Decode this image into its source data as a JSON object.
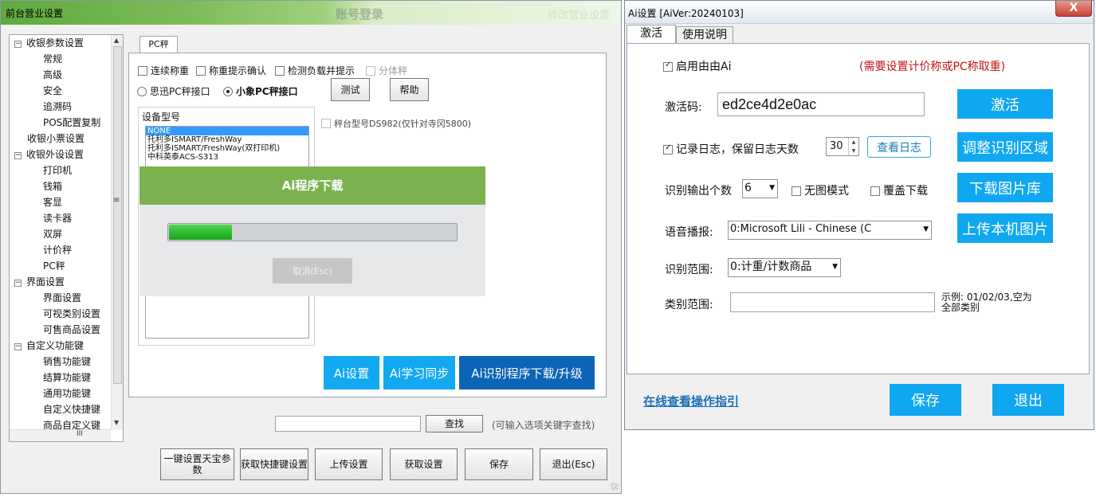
{
  "left_window": {
    "title": "前台营业设置",
    "ghost_title": "账号登录",
    "ghost_title_2": "修改营业设置",
    "tree": [
      {
        "label": "收银参数设置",
        "level": 0,
        "toggle": "−"
      },
      {
        "label": "常规",
        "level": 1
      },
      {
        "label": "高级",
        "level": 1
      },
      {
        "label": "安全",
        "level": 1
      },
      {
        "label": "追溯码",
        "level": 1
      },
      {
        "label": "POS配置复制",
        "level": 1
      },
      {
        "label": "收银小票设置",
        "level": 0,
        "toggle": ""
      },
      {
        "label": "收银外设设置",
        "level": 0,
        "toggle": "−"
      },
      {
        "label": "打印机",
        "level": 1
      },
      {
        "label": "钱箱",
        "level": 1
      },
      {
        "label": "客显",
        "level": 1
      },
      {
        "label": "读卡器",
        "level": 1
      },
      {
        "label": "双屏",
        "level": 1
      },
      {
        "label": "计价秤",
        "level": 1
      },
      {
        "label": "PC秤",
        "level": 1
      },
      {
        "label": "界面设置",
        "level": 0,
        "toggle": "−"
      },
      {
        "label": "界面设置",
        "level": 1
      },
      {
        "label": "可视类别设置",
        "level": 1
      },
      {
        "label": "可售商品设置",
        "level": 1
      },
      {
        "label": "自定义功能键",
        "level": 0,
        "toggle": "−"
      },
      {
        "label": "销售功能键",
        "level": 1
      },
      {
        "label": "结算功能键",
        "level": 1
      },
      {
        "label": "通用功能键",
        "level": 1
      },
      {
        "label": "自定义快捷键",
        "level": 1
      },
      {
        "label": "商品自定义键",
        "level": 1
      }
    ],
    "tab_label": "PC秤",
    "checkboxes": [
      {
        "label": "连续称重",
        "checked": false
      },
      {
        "label": "称重提示确认",
        "checked": false
      },
      {
        "label": "检测负载并提示",
        "checked": false
      },
      {
        "label": "分体秤",
        "checked": false,
        "disabled": true
      }
    ],
    "radio_sixun": "思迅PC秤接口",
    "radio_xiaoxiang": "小象PC秤接口",
    "test_button": "测试",
    "help_button": "帮助",
    "device_model_label": "设备型号",
    "devices": [
      "NONE",
      "托利多ISMART/FreshWay",
      "托利多ISMART/FreshWay(双打印机)",
      "中科英泰ACS-S313"
    ],
    "ds982_label": "秤台型号DS982(仅针对寺冈5800)",
    "download_dialog": {
      "title": "Ai程序下载",
      "progress": 0.22,
      "cancel_label": "取消(Esc)"
    },
    "ai_buttons": [
      "Ai设置",
      "Ai学习同步",
      "Ai识别程序下载/升级"
    ],
    "search_value": "",
    "search_button": "查找",
    "search_hint": "(可输入选项关键字查找)",
    "bottom_buttons": [
      "一键设置天宝参数",
      "获取快捷键设置",
      "上传设置",
      "获取设置",
      "保存",
      "退出(Esc)"
    ]
  },
  "right_window": {
    "title": "Ai设置 [AiVer:20240103]",
    "close_label": "X",
    "tabs": [
      "激活",
      "使用说明"
    ],
    "enable_ai_label": "启用由由Ai",
    "enable_ai_checked": true,
    "red_note": "(需要设置计价称或PC称取重)",
    "activation_label": "激活码:",
    "activation_code": "ed2ce4d2e0ac",
    "activate_button": "激活",
    "log_label": "记录日志，保留日志天数",
    "log_checked": true,
    "log_days": "30",
    "view_log_button": "查看日志",
    "adjust_area_button": "调整识别区域",
    "output_count_label": "识别输出个数",
    "output_count_value": "6",
    "no_image_label": "无图模式",
    "overwrite_label": "覆盖下载",
    "download_lib_button": "下载图片库",
    "voice_label": "语音播报:",
    "voice_value": "0:Microsoft Lili - Chinese (C",
    "upload_button": "上传本机图片",
    "range_label": "识别范围:",
    "range_value": "0:计重/计数商品",
    "category_label": "类别范围:",
    "category_value": "",
    "example_text_1": "示例: 01/02/03,空为",
    "example_text_2": "全部类别",
    "guide_link": "在线查看操作指引",
    "save_button": "保存",
    "exit_button": "退出"
  }
}
